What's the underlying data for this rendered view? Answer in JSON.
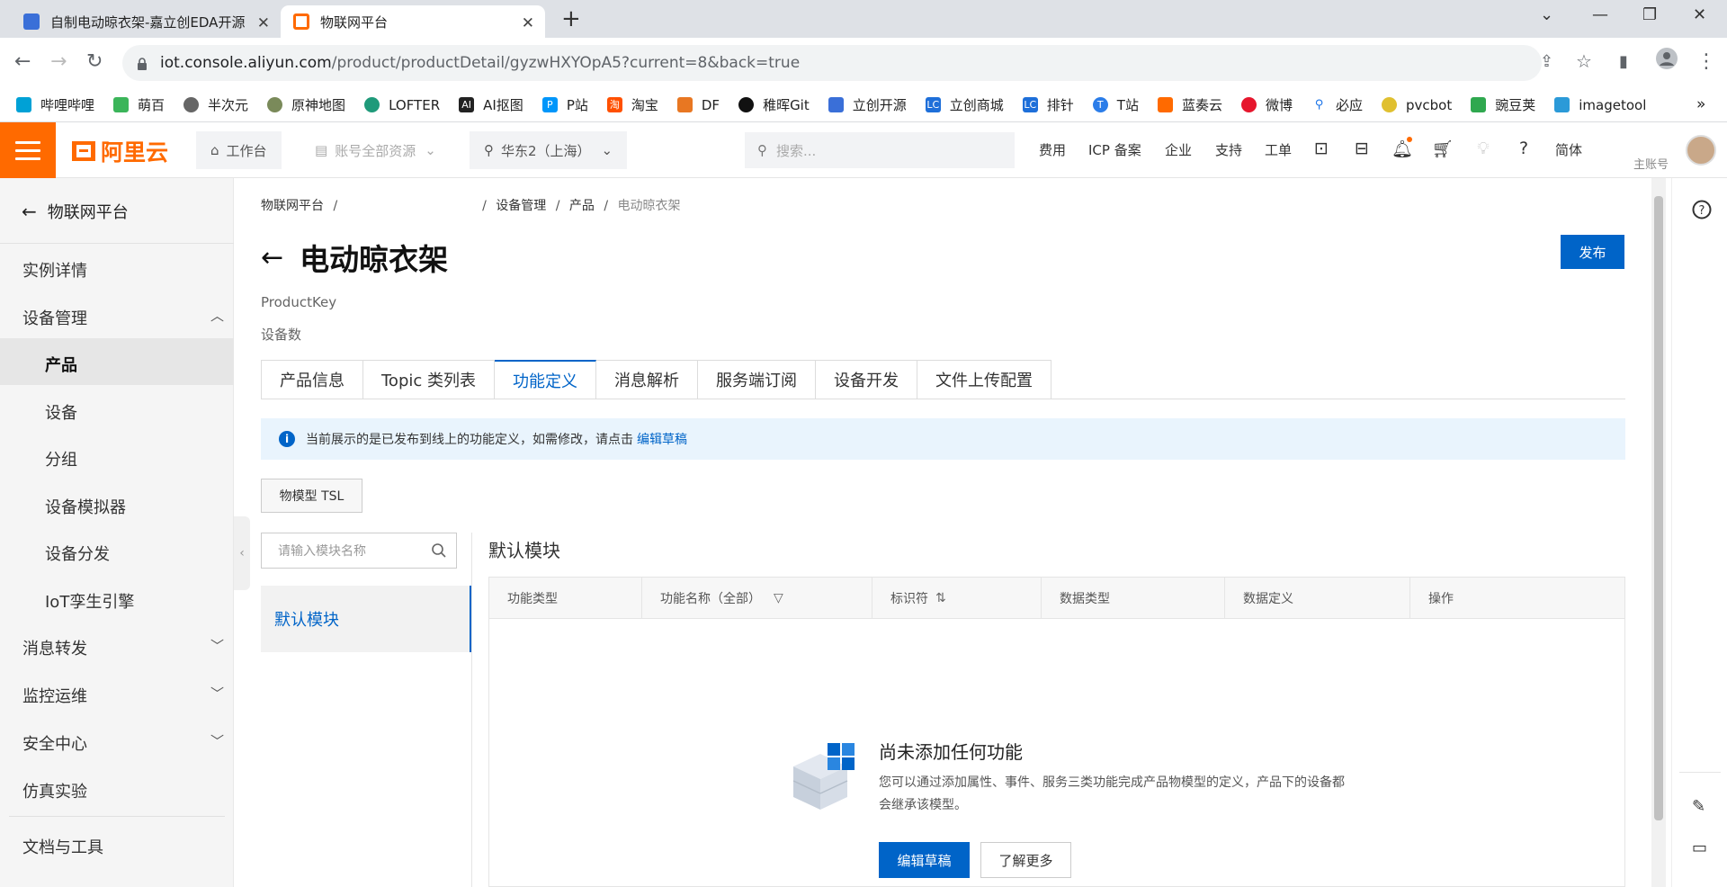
{
  "browser": {
    "tabs": [
      {
        "title": "自制电动晾衣架-嘉立创EDA开源"
      },
      {
        "title": "物联网平台"
      }
    ],
    "url_host": "iot.console.aliyun.com",
    "url_path": "/product/productDetail/gyzwHXYOpA5?current=8&back=true",
    "bookmarks": [
      "哔哩哔哩",
      "萌百",
      "半次元",
      "原神地图",
      "LOFTER",
      "AI抠图",
      "P站",
      "淘宝",
      "DF",
      "稚晖Git",
      "立创开源",
      "立创商城",
      "排针",
      "T站",
      "蓝奏云",
      "微博",
      "必应",
      "pvcbot",
      "豌豆荚",
      "imagetool"
    ],
    "bookmarks_more": "»"
  },
  "header": {
    "logo_text": "阿里云",
    "workbench": "工作台",
    "resources": "账号全部资源",
    "region": "华东2（上海）",
    "search_placeholder": "搜索...",
    "links": [
      "费用",
      "ICP 备案",
      "企业",
      "支持",
      "工单"
    ],
    "lang": "简体",
    "account": "主账号",
    "accent_color": "#ff6a00"
  },
  "sidebar": {
    "back_label": "物联网平台",
    "items": [
      {
        "label": "实例详情"
      },
      {
        "label": "设备管理"
      },
      {
        "label": "产品"
      },
      {
        "label": "设备"
      },
      {
        "label": "分组"
      },
      {
        "label": "设备模拟器"
      },
      {
        "label": "设备分发"
      },
      {
        "label": "IoT孪生引擎"
      },
      {
        "label": "消息转发"
      },
      {
        "label": "监控运维"
      },
      {
        "label": "安全中心"
      },
      {
        "label": "仿真实验"
      },
      {
        "label": "文档与工具"
      }
    ]
  },
  "breadcrumb": [
    "物联网平台",
    "设备管理",
    "产品",
    "电动晾衣架"
  ],
  "page": {
    "title": "电动晾衣架",
    "publish_label": "发布",
    "product_key_label": "ProductKey",
    "device_count_label": "设备数",
    "primary_color": "#0064c8"
  },
  "tabs": [
    "产品信息",
    "Topic 类列表",
    "功能定义",
    "消息解析",
    "服务端订阅",
    "设备开发",
    "文件上传配置"
  ],
  "notice": {
    "text": "当前展示的是已发布到线上的功能定义，如需修改，请点击",
    "link": "编辑草稿"
  },
  "tsl_button": "物模型 TSL",
  "module_search_placeholder": "请输入模块名称",
  "modules": [
    "默认模块"
  ],
  "module_title": "默认模块",
  "table": {
    "columns": [
      "功能类型",
      "功能名称（全部）",
      "标识符",
      "数据类型",
      "数据定义",
      "操作"
    ]
  },
  "empty": {
    "title": "尚未添加任何功能",
    "desc": "您可以通过添加属性、事件、服务三类功能完成产品物模型的定义，产品下的设备都会继承该模型。",
    "primary": "编辑草稿",
    "secondary": "了解更多"
  }
}
